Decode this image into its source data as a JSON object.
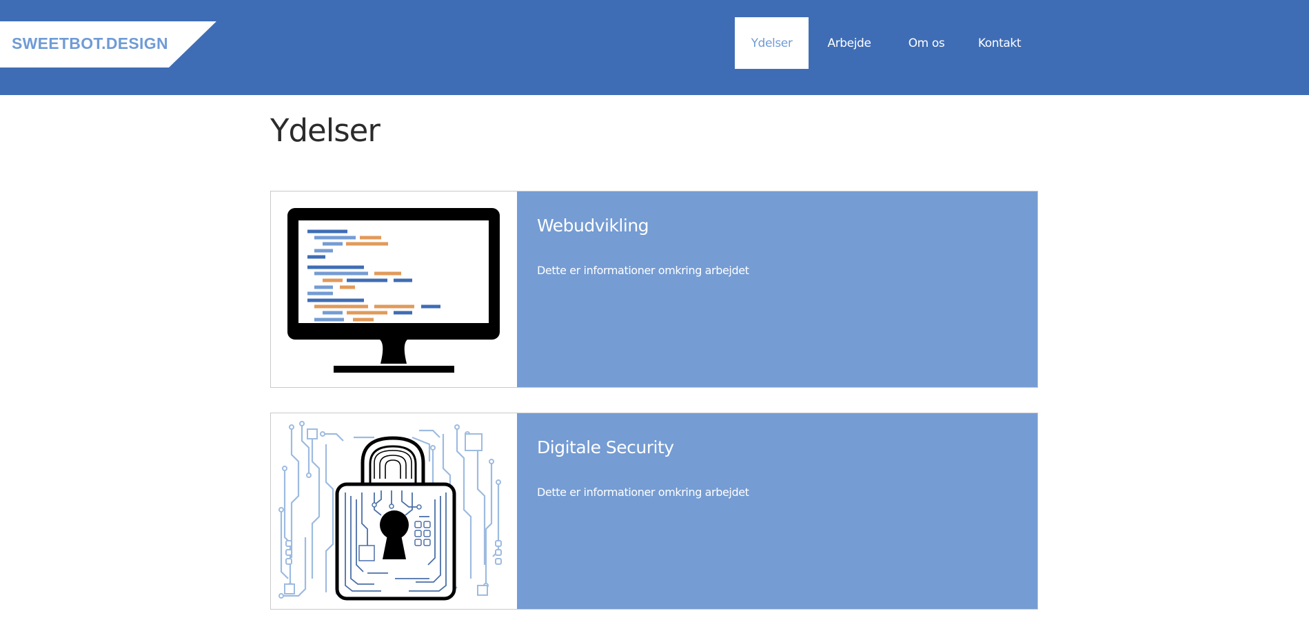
{
  "header": {
    "logo_text": "SWEETBOT.DESIGN",
    "nav": [
      {
        "label": "Ydelser",
        "active": true
      },
      {
        "label": "Arbejde",
        "active": false
      },
      {
        "label": "Om os",
        "active": false
      },
      {
        "label": "Kontakt",
        "active": false
      }
    ]
  },
  "page": {
    "title": "Ydelser"
  },
  "services": [
    {
      "title": "Webudvikling",
      "text": "Dette er informationer omkring arbejdet",
      "icon": "computer-monitor-code-icon"
    },
    {
      "title": "Digitale Security",
      "text": "Dette er informationer omkring arbejdet",
      "icon": "circuit-padlock-icon"
    }
  ],
  "colors": {
    "header_bg": "#3f6db5",
    "card_bg": "#759cd3",
    "logo_text": "#6f9bd6",
    "code_blue": "#3f6db5",
    "code_orange": "#e19a5a"
  }
}
